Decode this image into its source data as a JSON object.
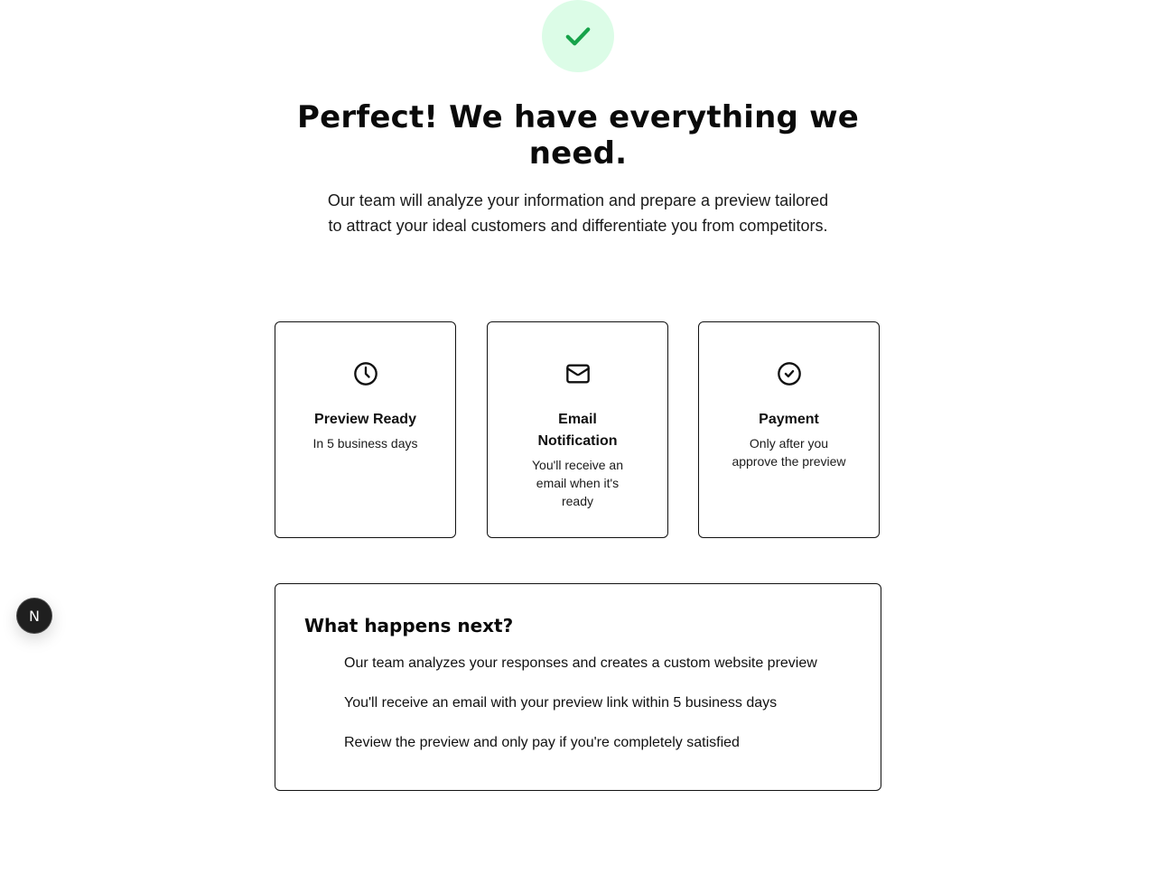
{
  "hero": {
    "icon": "check-icon",
    "accent_color": "#16a34a",
    "badge_color": "#dcfce7",
    "title": "Perfect! We have everything we need.",
    "subtitle": "Our team will analyze your information and prepare a preview tailored to attract your ideal customers and differentiate you from competitors."
  },
  "cards": [
    {
      "icon": "clock-icon",
      "title": "Preview Ready",
      "description": "In 5 business days"
    },
    {
      "icon": "mail-icon",
      "title": "Email Notification",
      "description": "You'll receive an email when it's ready"
    },
    {
      "icon": "check-circle-icon",
      "title": "Payment",
      "description": "Only after you approve the preview"
    }
  ],
  "next_steps": {
    "title": "What happens next?",
    "items": [
      "Our team analyzes your responses and creates a custom website preview",
      "You'll receive an email with your preview link within 5 business days",
      "Review the preview and only pay if you're completely satisfied"
    ]
  },
  "dev_badge": {
    "label": "N",
    "icon": "nextjs-logo-icon"
  }
}
